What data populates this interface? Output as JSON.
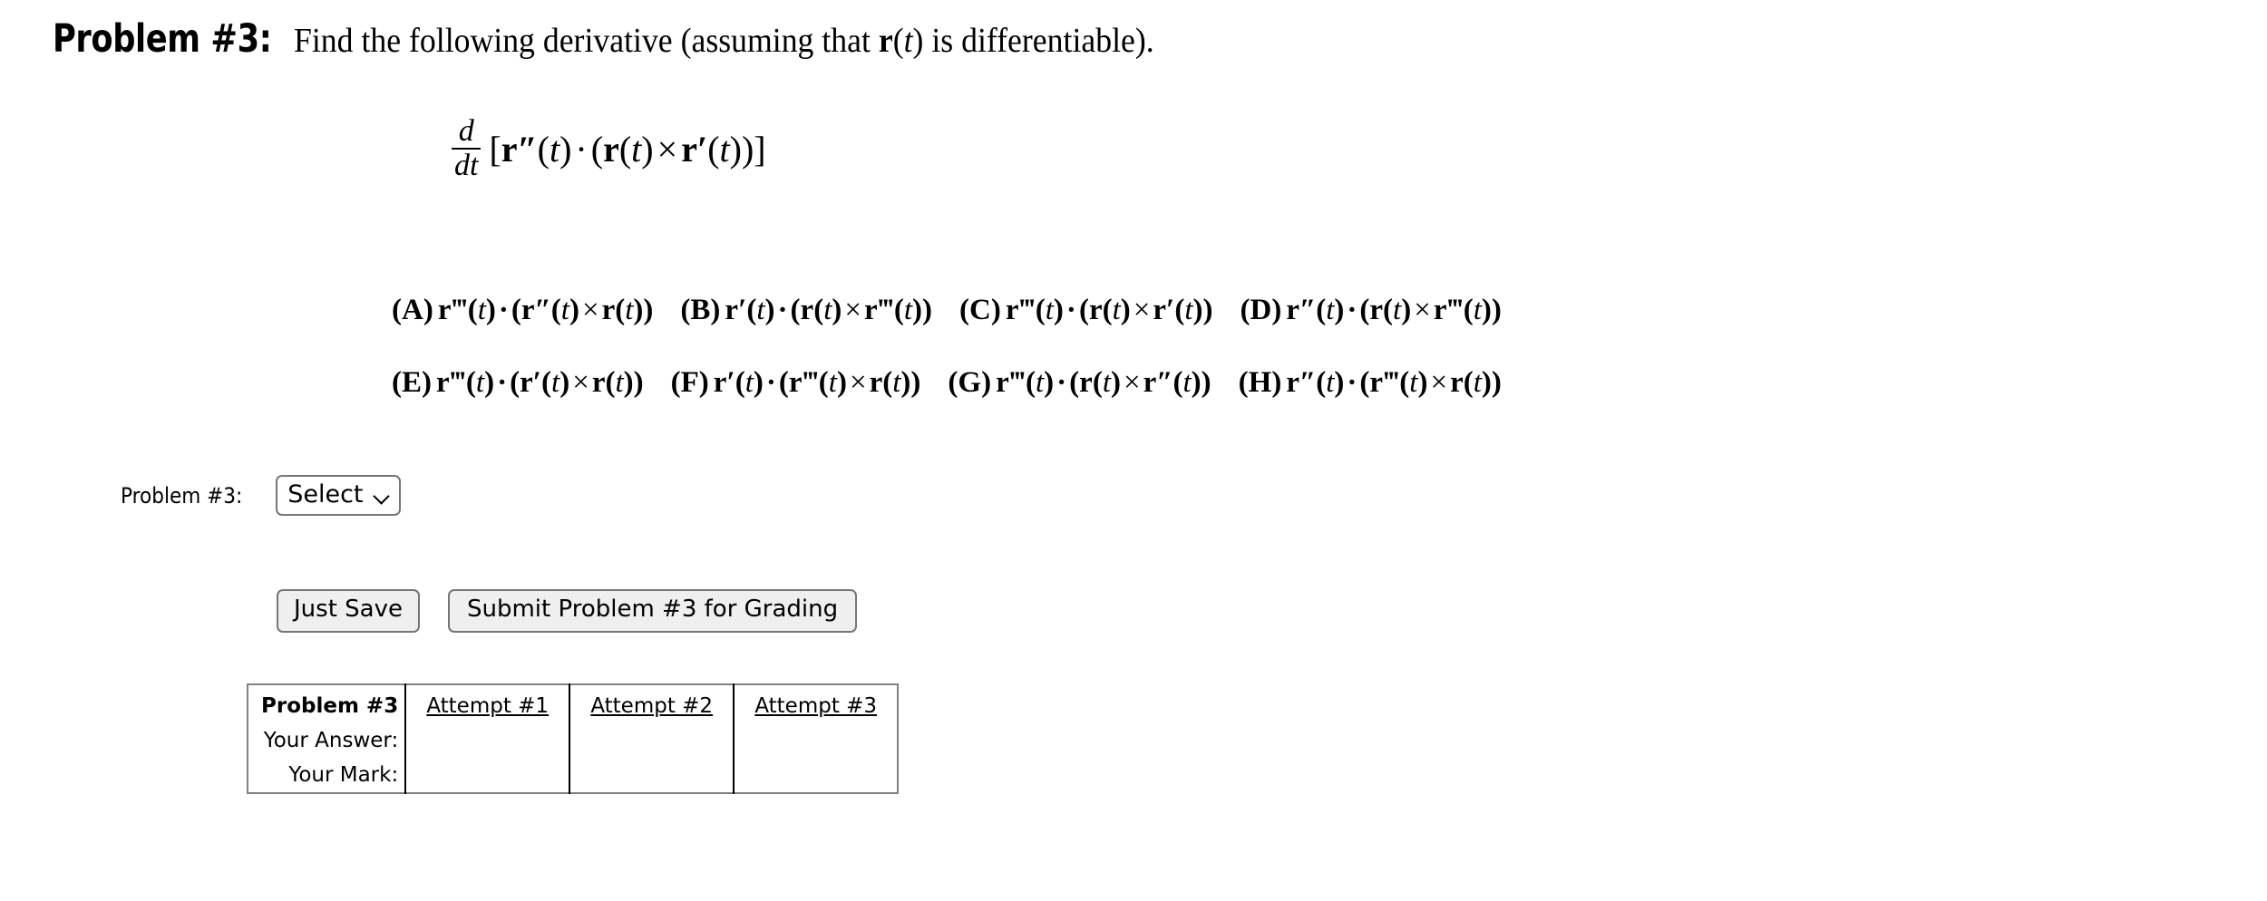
{
  "problem": {
    "label": "Problem #3:",
    "statement_prefix": "Find the following derivative (assuming that ",
    "statement_vector": "r",
    "statement_var": "t",
    "statement_suffix": ") is differentiable)."
  },
  "formula": {
    "d": "d",
    "dt": "dt",
    "open_bracket": "[",
    "term1_vec": "r",
    "term1_prime": "″",
    "term1_arg": "t",
    "dot": "·",
    "term2_vec": "r",
    "term2_arg": "t",
    "cross": "×",
    "term3_vec": "r",
    "term3_prime": "′",
    "term3_arg": "t",
    "close_bracket": "]"
  },
  "options": [
    {
      "letter": "(A)",
      "first": "r‴(t)",
      "second": "r″(t)",
      "third": "r(t)"
    },
    {
      "letter": "(B)",
      "first": "r′(t)",
      "second": "r(t)",
      "third": "r‴(t)"
    },
    {
      "letter": "(C)",
      "first": "r‴(t)",
      "second": "r(t)",
      "third": "r′(t)"
    },
    {
      "letter": "(D)",
      "first": "r″(t)",
      "second": "r(t)",
      "third": "r‴(t)"
    },
    {
      "letter": "(E)",
      "first": "r‴(t)",
      "second": "r′(t)",
      "third": "r(t)"
    },
    {
      "letter": "(F)",
      "first": "r′(t)",
      "second": "r‴(t)",
      "third": "r(t)"
    },
    {
      "letter": "(G)",
      "first": "r‴(t)",
      "second": "r(t)",
      "third": "r″(t)"
    },
    {
      "letter": "(H)",
      "first": "r″(t)",
      "second": "r‴(t)",
      "third": "r(t)"
    }
  ],
  "answer_select": {
    "label": "Problem #3:",
    "value": "Select"
  },
  "buttons": {
    "save": "Just Save",
    "submit": "Submit Problem #3 for Grading"
  },
  "results": {
    "header_label": "Problem #3",
    "row_answer_label": "Your Answer:",
    "row_mark_label": "Your Mark:",
    "attempts": [
      "Attempt #1",
      "Attempt #2",
      "Attempt #3"
    ],
    "answer_values": [
      "",
      "",
      ""
    ],
    "mark_values": [
      "",
      "",
      ""
    ]
  },
  "colors": {
    "page_background": "#ffffff",
    "text": "#000000",
    "button_background": "#efefef",
    "control_border": "#767676",
    "table_outer_border": "#808080",
    "table_inner_border": "#000000"
  }
}
